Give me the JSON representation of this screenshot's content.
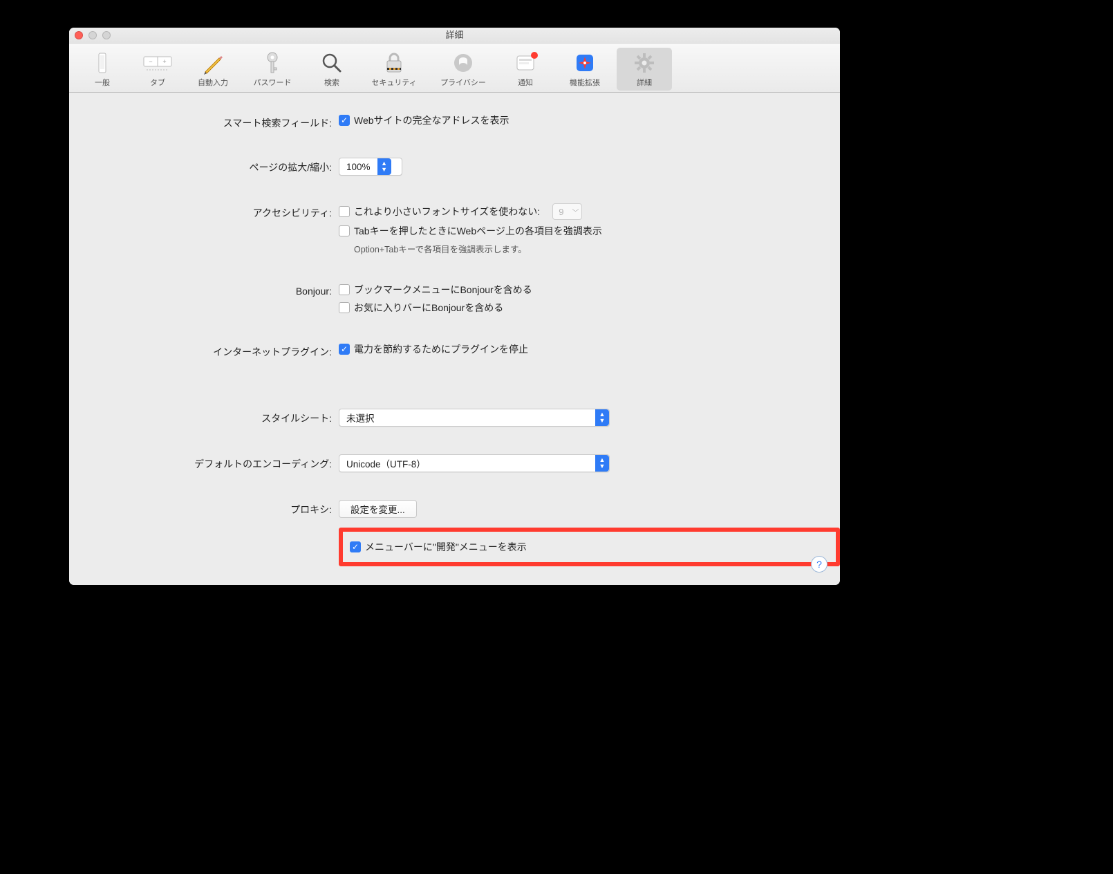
{
  "window": {
    "title": "詳細"
  },
  "toolbar": {
    "items": [
      {
        "label": "一般"
      },
      {
        "label": "タブ"
      },
      {
        "label": "自動入力"
      },
      {
        "label": "パスワード"
      },
      {
        "label": "検索"
      },
      {
        "label": "セキュリティ"
      },
      {
        "label": "プライバシー"
      },
      {
        "label": "通知"
      },
      {
        "label": "機能拡張"
      },
      {
        "label": "詳細"
      }
    ]
  },
  "sections": {
    "smartSearch": {
      "label": "スマート検索フィールド:",
      "checkbox": "Webサイトの完全なアドレスを表示",
      "checked": true
    },
    "zoom": {
      "label": "ページの拡大/縮小:",
      "value": "100%"
    },
    "accessibility": {
      "label": "アクセシビリティ:",
      "fontCheckbox": "これより小さいフォントサイズを使わない:",
      "fontSize": "9",
      "tabCheckbox": "Tabキーを押したときにWebページ上の各項目を強調表示",
      "note": "Option+Tabキーで各項目を強調表示します。"
    },
    "bonjour": {
      "label": "Bonjour:",
      "bm": "ブックマークメニューにBonjourを含める",
      "fav": "お気に入りバーにBonjourを含める"
    },
    "plugins": {
      "label": "インターネットプラグイン:",
      "checkbox": "電力を節約するためにプラグインを停止",
      "checked": true
    },
    "stylesheet": {
      "label": "スタイルシート:",
      "value": "未選択"
    },
    "encoding": {
      "label": "デフォルトのエンコーディング:",
      "value": "Unicode（UTF-8）"
    },
    "proxy": {
      "label": "プロキシ:",
      "button": "設定を変更..."
    },
    "developMenu": {
      "checkbox": "メニューバーに\"開発\"メニューを表示",
      "checked": true
    }
  },
  "help": "?"
}
